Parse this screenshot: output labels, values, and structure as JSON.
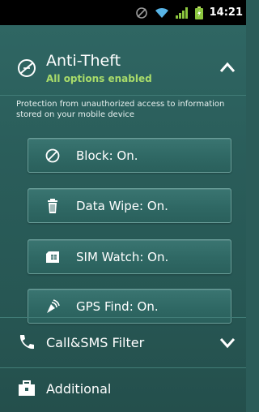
{
  "status_bar": {
    "time": "14:21",
    "icons": [
      "sync-icon",
      "wifi-icon",
      "signal-icon",
      "battery-icon"
    ]
  },
  "anti_theft": {
    "title": "Anti-Theft",
    "subtitle": "All options enabled",
    "description": "Protection from unauthorized access to information stored on your mobile device",
    "expanded": true,
    "icon": "anti-theft-icon"
  },
  "options": [
    {
      "label": "Block: On.",
      "icon": "block-icon"
    },
    {
      "label": "Data Wipe: On.",
      "icon": "trash-icon"
    },
    {
      "label": "SIM Watch: On.",
      "icon": "sim-card-icon"
    },
    {
      "label": "GPS Find: On.",
      "icon": "satellite-icon"
    }
  ],
  "call_sms": {
    "title": "Call&SMS Filter",
    "icon": "phone-icon",
    "expanded": false
  },
  "additional": {
    "title": "Additional",
    "icon": "toolbox-icon"
  },
  "colors": {
    "background": "#2b5c59",
    "subtitle_green": "#a9dc6a",
    "button_border": "#6a9e99",
    "status_bar": "#000000"
  }
}
